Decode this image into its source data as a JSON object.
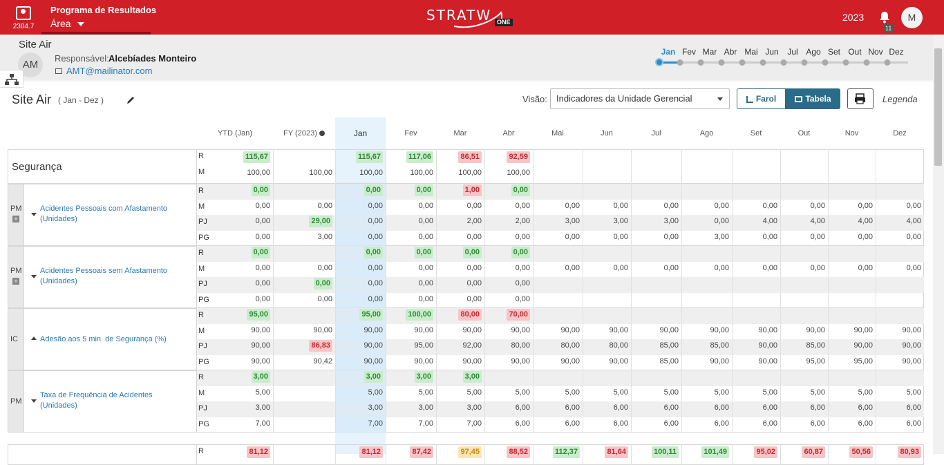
{
  "topbar": {
    "version": "2304.7",
    "program_title": "Programa de Resultados",
    "area_label": "Área",
    "logo_text": "STRATW",
    "logo_badge": "ONE",
    "year": "2023",
    "notification_count": "11",
    "user_initial": "M"
  },
  "unit": {
    "name": "Site Air",
    "avatar": "AM",
    "responsible_label": "Responsável:",
    "responsible_name": "Alcebíades Monteiro",
    "email": "AMT@mailinator.com"
  },
  "month_selector": {
    "months": [
      "Jan",
      "Fev",
      "Mar",
      "Abr",
      "Mai",
      "Jun",
      "Jul",
      "Ago",
      "Set",
      "Out",
      "Nov",
      "Dez"
    ],
    "selected": "Jan"
  },
  "toolbar": {
    "page_title": "Site Air",
    "page_range": "( Jan - Dez )",
    "visao_label": "Visão:",
    "visao_value": "Indicadores da Unidade Gerencial",
    "farol_label": "Farol",
    "tabela_label": "Tabela",
    "legenda_label": "Legenda"
  },
  "table": {
    "headers": [
      "YTD (Jan)",
      "FY (2023)",
      "Jan",
      "Fev",
      "Mar",
      "Abr",
      "Mai",
      "Jun",
      "Jul",
      "Ago",
      "Set",
      "Out",
      "Nov",
      "Dez"
    ],
    "section_title": "Segurança",
    "section_rows": {
      "R": [
        {
          "v": "115,67",
          "c": "g"
        },
        null,
        {
          "v": "115,67",
          "c": "g"
        },
        {
          "v": "117,06",
          "c": "g"
        },
        {
          "v": "86,51",
          "c": "r"
        },
        {
          "v": "92,59",
          "c": "r"
        },
        null,
        null,
        null,
        null,
        null,
        null,
        null,
        null
      ],
      "M": [
        "100,00",
        "100,00",
        "100,00",
        "100,00",
        "100,00",
        "100,00",
        "",
        "",
        "",
        "",
        "",
        "",
        "",
        ""
      ]
    },
    "indicators": [
      {
        "type": "PM",
        "plus": true,
        "caret": "down",
        "name": "Acidentes Pessoais com Afastamento (Unidades)",
        "rows": {
          "R": [
            {
              "v": "0,00",
              "c": "g"
            },
            null,
            {
              "v": "0,00",
              "c": "g"
            },
            {
              "v": "0,00",
              "c": "g"
            },
            {
              "v": "1,00",
              "c": "r"
            },
            {
              "v": "0,00",
              "c": "g"
            },
            null,
            null,
            null,
            null,
            null,
            null,
            null,
            null
          ],
          "M": [
            "0,00",
            "0,00",
            "0,00",
            "0,00",
            "0,00",
            "0,00",
            "0,00",
            "0,00",
            "0,00",
            "0,00",
            "0,00",
            "0,00",
            "0,00",
            "0,00"
          ],
          "PJ": [
            "0,00",
            {
              "v": "29,00",
              "c": "g"
            },
            "0,00",
            "0,00",
            "2,00",
            "2,00",
            "3,00",
            "3,00",
            "3,00",
            "0,00",
            "4,00",
            "4,00",
            "4,00",
            "4,00"
          ],
          "PG": [
            "0,00",
            "3,00",
            "0,00",
            "0,00",
            "0,00",
            "0,00",
            "0,00",
            "0,00",
            "0,00",
            "3,00",
            "0,00",
            "0,00",
            "0,00",
            "0,00"
          ]
        }
      },
      {
        "type": "PM",
        "plus": true,
        "caret": "down",
        "name": "Acidentes Pessoais sem Afastamento (Unidades)",
        "rows": {
          "R": [
            {
              "v": "0,00",
              "c": "g"
            },
            null,
            {
              "v": "0,00",
              "c": "g"
            },
            {
              "v": "0,00",
              "c": "g"
            },
            {
              "v": "0,00",
              "c": "g"
            },
            {
              "v": "0,00",
              "c": "g"
            },
            null,
            null,
            null,
            null,
            null,
            null,
            null,
            null
          ],
          "M": [
            "0,00",
            "0,00",
            "0,00",
            "0,00",
            "0,00",
            "0,00",
            "0,00",
            "0,00",
            "0,00",
            "0,00",
            "0,00",
            "0,00",
            "0,00",
            "0,00"
          ],
          "PJ": [
            "0,00",
            {
              "v": "0,00",
              "c": "g"
            },
            "0,00",
            "0,00",
            "0,00",
            "0,00",
            "",
            "",
            "",
            "",
            "",
            "",
            "",
            ""
          ],
          "PG": [
            "0,00",
            "0,00",
            "0,00",
            "0,00",
            "0,00",
            "0,00",
            "",
            "",
            "",
            "",
            "",
            "",
            "",
            ""
          ]
        }
      },
      {
        "type": "IC",
        "plus": false,
        "caret": "up",
        "name": "Adesão aos 5 min. de Segurança (%)",
        "rows": {
          "R": [
            {
              "v": "95,00",
              "c": "g"
            },
            null,
            {
              "v": "95,00",
              "c": "g"
            },
            {
              "v": "100,00",
              "c": "g"
            },
            {
              "v": "80,00",
              "c": "r"
            },
            {
              "v": "70,00",
              "c": "r"
            },
            null,
            null,
            null,
            null,
            null,
            null,
            null,
            null
          ],
          "M": [
            "90,00",
            "90,00",
            "90,00",
            "90,00",
            "90,00",
            "90,00",
            "90,00",
            "90,00",
            "90,00",
            "90,00",
            "90,00",
            "90,00",
            "90,00",
            "90,00"
          ],
          "PJ": [
            "90,00",
            {
              "v": "86,83",
              "c": "r"
            },
            "90,00",
            "95,00",
            "92,00",
            "80,00",
            "80,00",
            "80,00",
            "85,00",
            "85,00",
            "90,00",
            "85,00",
            "90,00",
            "90,00"
          ],
          "PG": [
            "90,00",
            "90,42",
            "90,00",
            "90,00",
            "90,00",
            "90,00",
            "90,00",
            "90,00",
            "85,00",
            "90,00",
            "90,00",
            "95,00",
            "95,00",
            "90,00"
          ]
        }
      },
      {
        "type": "PM",
        "plus": false,
        "caret": "down",
        "name": "Taxa de Frequência de Acidentes (Unidades)",
        "rows": {
          "R": [
            {
              "v": "3,00",
              "c": "g"
            },
            null,
            {
              "v": "3,00",
              "c": "g"
            },
            {
              "v": "3,00",
              "c": "g"
            },
            {
              "v": "3,00",
              "c": "g"
            },
            null,
            null,
            null,
            null,
            null,
            null,
            null,
            null,
            null
          ],
          "M": [
            "5,00",
            "",
            "5,00",
            "5,00",
            "5,00",
            "5,00",
            "5,00",
            "5,00",
            "5,00",
            "5,00",
            "5,00",
            "5,00",
            "5,00",
            "5,00"
          ],
          "PJ": [
            "3,00",
            "",
            "3,00",
            "3,00",
            "3,00",
            "6,00",
            "6,00",
            "6,00",
            "6,00",
            "6,00",
            "6,00",
            "6,00",
            "6,00",
            "6,00"
          ],
          "PG": [
            "7,00",
            "",
            "7,00",
            "7,00",
            "7,00",
            "6,00",
            "6,00",
            "6,00",
            "6,00",
            "6,00",
            "6,00",
            "6,00",
            "6,00",
            "6,00"
          ]
        }
      }
    ],
    "next_section_R": [
      {
        "v": "81,12",
        "c": "r"
      },
      null,
      {
        "v": "81,12",
        "c": "r"
      },
      {
        "v": "87,42",
        "c": "r"
      },
      {
        "v": "97,45",
        "c": "y"
      },
      {
        "v": "88,52",
        "c": "r"
      },
      {
        "v": "112,37",
        "c": "g"
      },
      {
        "v": "81,64",
        "c": "r"
      },
      {
        "v": "100,11",
        "c": "g"
      },
      {
        "v": "101,49",
        "c": "g"
      },
      {
        "v": "95,02",
        "c": "r"
      },
      {
        "v": "60,87",
        "c": "r"
      },
      {
        "v": "50,56",
        "c": "r"
      },
      {
        "v": "80,93",
        "c": "r"
      }
    ]
  }
}
